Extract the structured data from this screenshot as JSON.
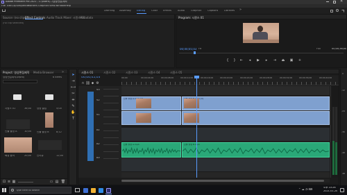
{
  "app": {
    "title": "Adobe Premiere Pro 2021 - C:\\Users\\...\\영상편집\\제작",
    "menu": [
      "File",
      "Edit",
      "Clip",
      "Sequence",
      "Markers",
      "Graphics",
      "View",
      "Window",
      "Help"
    ]
  },
  "workspaces": {
    "items": [
      "Learning",
      "Assembly",
      "Editing",
      "Color",
      "Effects",
      "Audio",
      "Graphics",
      "Captions",
      "Libraries"
    ],
    "active": "Editing"
  },
  "source_panel": {
    "tabs": [
      "Source: (no clips)",
      "Effect Controls",
      "Audio Track Mixer: 시퀀스 01",
      "Metadata"
    ],
    "active_tab": "Effect Controls",
    "empty_label": "(no clip selected)"
  },
  "program_panel": {
    "title": "Program: 시퀀스 01",
    "timecode": "00;00;05;03",
    "fit_label": "Fit",
    "quality_label": "Full",
    "duration": "00;00;36;00"
  },
  "project_panel": {
    "tabs": [
      "Project: 영상편집제작",
      "Media Browser",
      "Libraries",
      "Info"
    ],
    "active_tab": "Project: 영상편집제작",
    "path": "영상편집제작.prproj",
    "search_placeholder": "",
    "item_count": "6 items",
    "items": [
      {
        "name": "시퀀스 01",
        "duration": "36;00",
        "kind": "folder"
      },
      {
        "name": "영상 클립",
        "duration": "5;00",
        "kind": "folder"
      },
      {
        "name": "인물 촬영 A",
        "duration": "10;00",
        "kind": "video"
      },
      {
        "name": "인물 촬영 B",
        "duration": "8;12",
        "kind": "video-portrait"
      },
      {
        "name": "배경 음악",
        "duration": "20;00",
        "kind": "audio"
      },
      {
        "name": "인터뷰",
        "duration": "12;00",
        "kind": "video"
      }
    ]
  },
  "timeline": {
    "tabs": [
      "시퀀스 01",
      "시퀀스 02",
      "시퀀스 03",
      "시퀀스 04",
      "시퀀스 05"
    ],
    "active_tab": "시퀀스 01",
    "timecode": "00;00;05;03",
    "ruler": [
      "00;00",
      "00;00;04;00",
      "00;00;08;00",
      "00;00;12;00",
      "00;00;16;00",
      "00;00;20;00",
      "00;00;24;00",
      "00;00;28;00",
      "00;00;32;00",
      "00;00;36;00",
      "00;00;40;00"
    ],
    "tracks": {
      "video": [
        "V3",
        "V2",
        "V1"
      ],
      "audio": [
        "A1",
        "A2",
        "A3"
      ]
    },
    "video_clips": [
      {
        "label": "인물 촬영 A.mp4 [V]"
      },
      {
        "label": "인물 촬영 B.mp4 [V]"
      }
    ],
    "audio_clips": [
      {
        "label": "인물 촬영 A.mp4"
      },
      {
        "label": "인물 촬영 B.mp4"
      }
    ],
    "meter_labels": [
      "0",
      "-12",
      "-24",
      "-36",
      "-48",
      "dB"
    ]
  },
  "taskbar": {
    "search_placeholder": "Type here to search",
    "time": "오후 10:26",
    "date": "2021-01-20",
    "icon_colors": [
      "#3d6fd4",
      "#f2b233",
      "#2f8ae5",
      "#8a4fd1",
      "#1aa3a0",
      "#2e2e6e",
      "#9b59e0"
    ]
  }
}
